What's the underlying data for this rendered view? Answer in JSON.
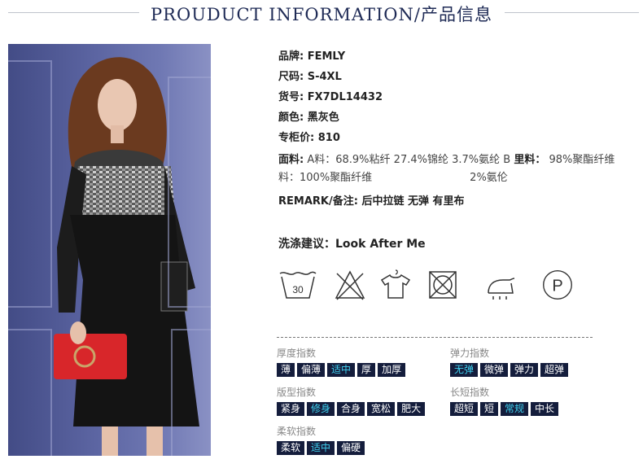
{
  "header": {
    "title": "PROUDUCT INFORMATION/产品信息"
  },
  "info": [
    {
      "label": "品牌:",
      "value": "FEMLY"
    },
    {
      "label": "尺码:",
      "value": "S-4XL"
    },
    {
      "label": "货号:",
      "value": "FX7DL14432"
    },
    {
      "label": "颜色:",
      "value": "黑灰色"
    },
    {
      "label": "专柜价:",
      "value": "810"
    }
  ],
  "fabric": {
    "label": "面料:",
    "line1": "A料：68.9%粘纤 27.4%锦纶 3.7%氨纶 B",
    "line1b": "里料：",
    "line1c": "98%聚酯纤维",
    "line2a": "料：100%聚酯纤维",
    "line2b": "2%氨伦"
  },
  "remark": {
    "label": "REMARK/备注:",
    "value": "后中拉链 无弹 有里布"
  },
  "care": {
    "label": "洗涤建议：",
    "value": "Look After Me",
    "wash_temp": "30"
  },
  "indexes": {
    "thickness": {
      "title": "厚度指数",
      "options": [
        "薄",
        "偏薄",
        "适中",
        "厚",
        "加厚"
      ],
      "selected": "适中"
    },
    "elasticity": {
      "title": "弹力指数",
      "options": [
        "无弹",
        "微弹",
        "弹力",
        "超弹"
      ],
      "selected": "无弹"
    },
    "fit": {
      "title": "版型指数",
      "options": [
        "紧身",
        "修身",
        "合身",
        "宽松",
        "肥大"
      ],
      "selected": "修身"
    },
    "length": {
      "title": "长短指数",
      "options": [
        "超短",
        "短",
        "常规",
        "中长"
      ],
      "selected": "常规"
    },
    "softness": {
      "title": "柔软指数",
      "options": [
        "柔软",
        "适中",
        "偏硬"
      ],
      "selected": "适中"
    }
  },
  "colors": {
    "accent": "#1e2a55",
    "chip_bg": "#141d3c",
    "chip_selected_text": "#3fd0ee"
  }
}
